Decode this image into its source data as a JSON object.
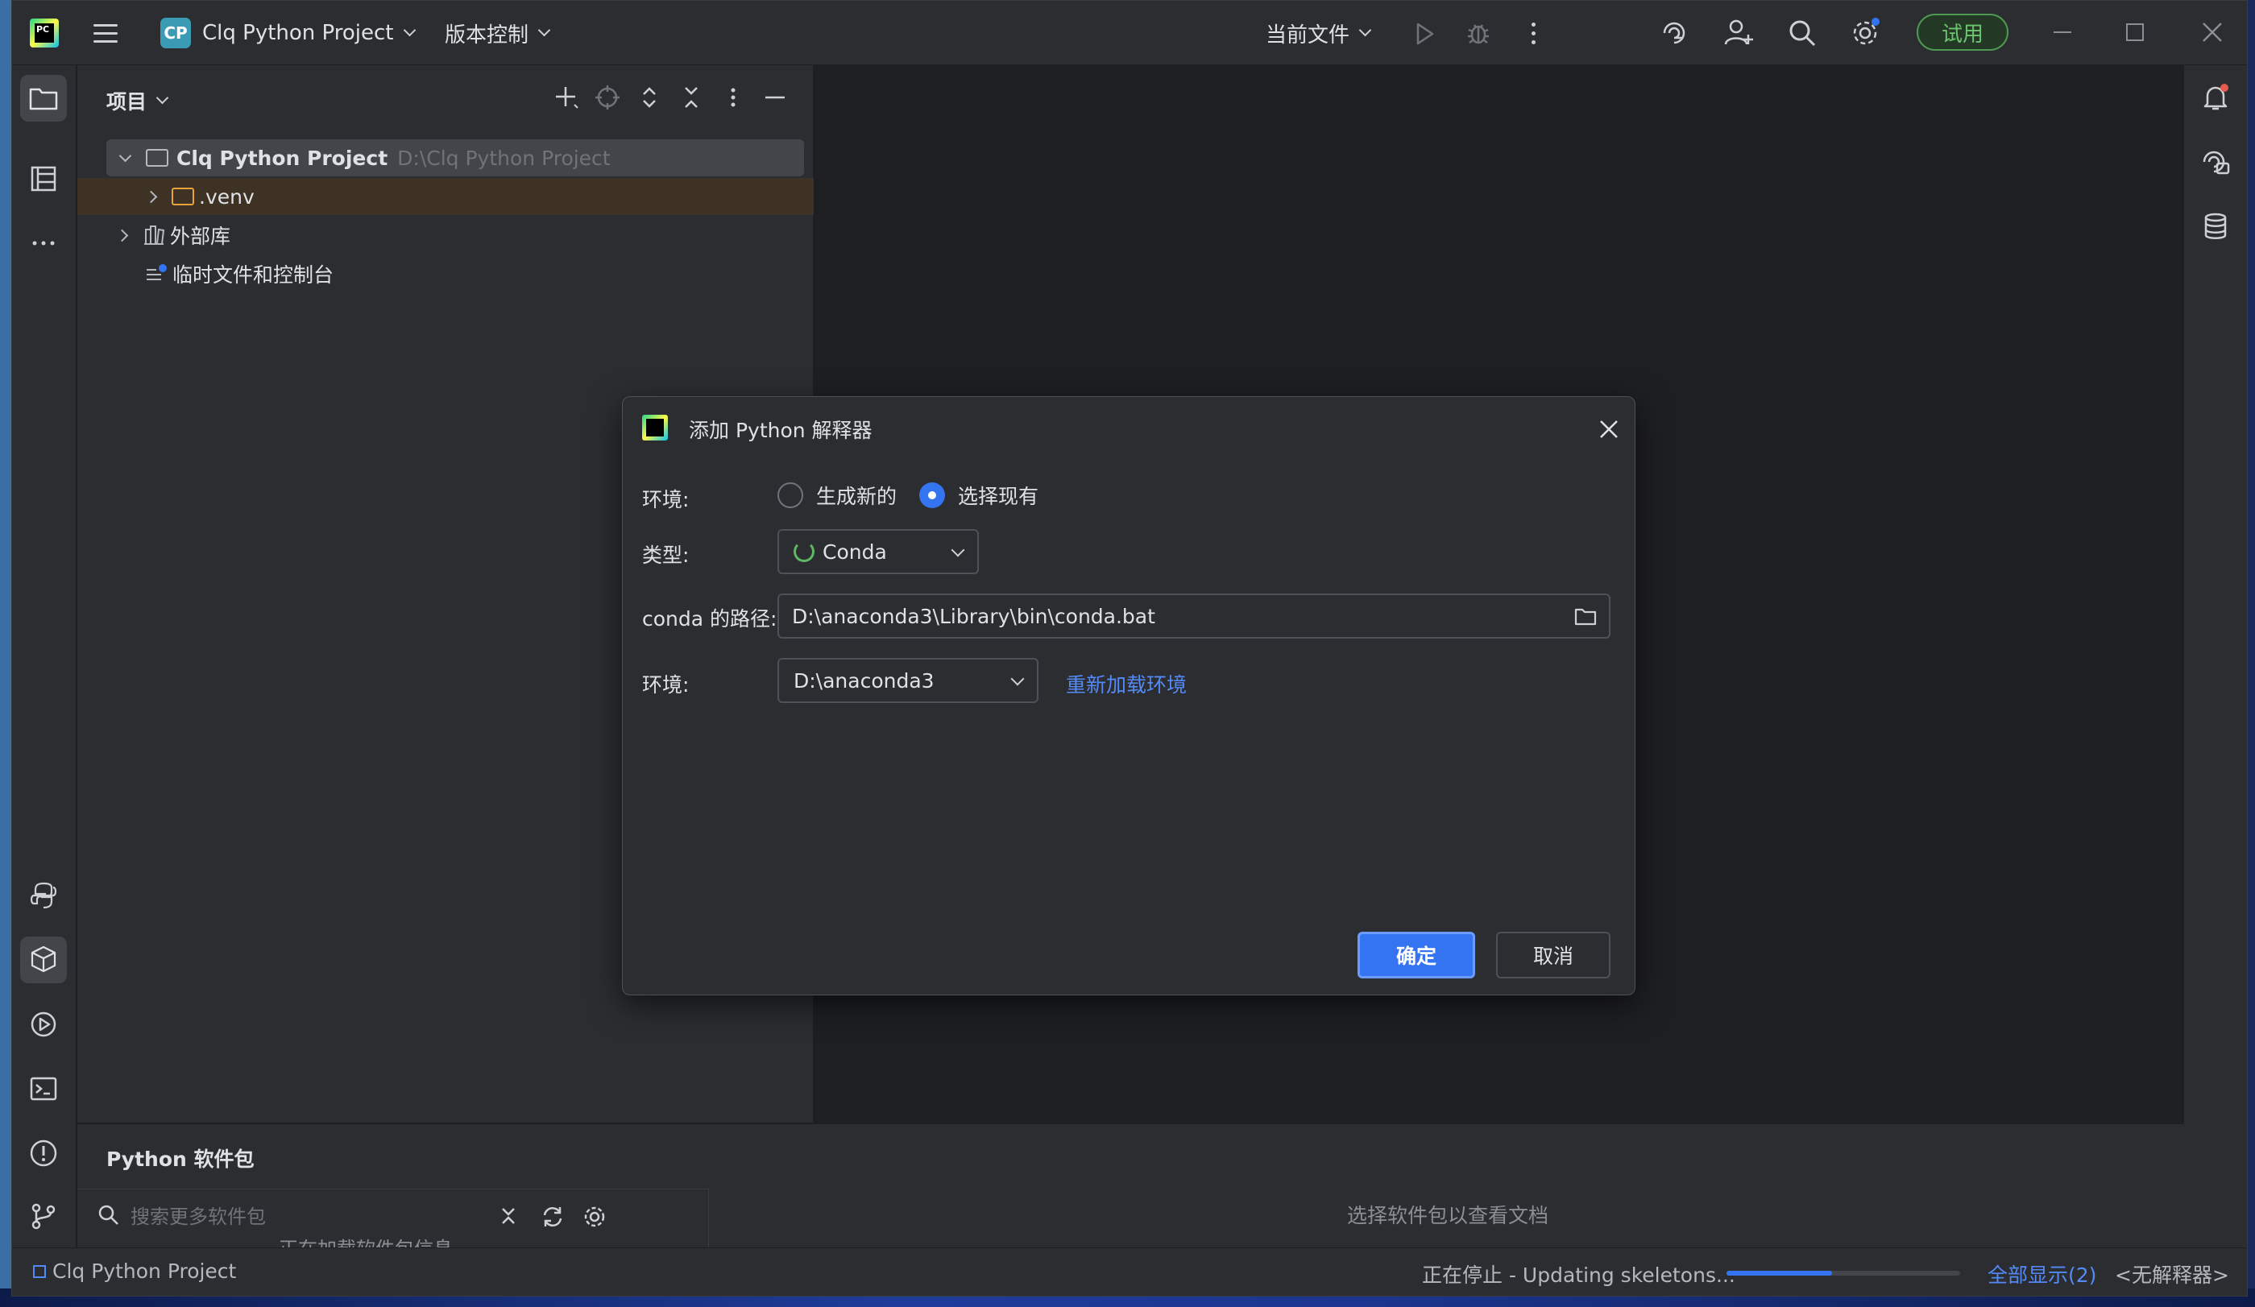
{
  "titlebar": {
    "project_badge": "CP",
    "project_name": "Clq Python Project",
    "vcs_label": "版本控制",
    "current_file_label": "当前文件",
    "trial_label": "试用"
  },
  "project_panel": {
    "title": "项目",
    "tree": [
      {
        "label": "Clq Python Project",
        "path": "D:\\Clq Python Project"
      },
      {
        "label": ".venv"
      },
      {
        "label": "外部库"
      },
      {
        "label": "临时文件和控制台"
      }
    ]
  },
  "packages_panel": {
    "title": "Python 软件包",
    "search_placeholder": "搜索更多软件包",
    "loading_text": "正在加载软件包信息",
    "docs_hint": "选择软件包以查看文档"
  },
  "statusbar": {
    "project": "Clq Python Project",
    "task": "正在停止 - Updating skeletons...",
    "progress": 0.45,
    "show_all": "全部显示(2)",
    "interpreter": "<无解释器>"
  },
  "dialog": {
    "title": "添加 Python 解释器",
    "env_label": "环境:",
    "radio_new": "生成新的",
    "radio_existing": "选择现有",
    "radio_selected": "existing",
    "type_label": "类型:",
    "type_value": "Conda",
    "conda_path_label": "conda 的路径:",
    "conda_path_value": "D:\\anaconda3\\Library\\bin\\conda.bat",
    "env2_label": "环境:",
    "env2_value": "D:\\anaconda3",
    "reload_link": "重新加载环境",
    "ok_label": "确定",
    "cancel_label": "取消"
  },
  "colors": {
    "accent": "#3574f0",
    "link": "#548af7",
    "trial_green": "#6cc46f",
    "venv_folder": "#e8a33d"
  }
}
